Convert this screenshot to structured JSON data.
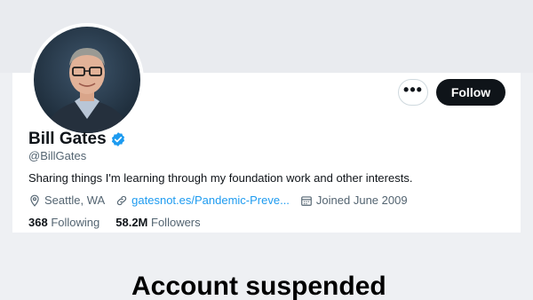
{
  "profile": {
    "name": "Bill Gates",
    "handle": "@BillGates",
    "bio": "Sharing things I'm learning through my foundation work and other interests.",
    "location": "Seattle, WA",
    "website": "gatesnot.es/Pandemic-Preve...",
    "joined": "Joined June 2009",
    "following_count": "368",
    "following_label": "Following",
    "followers_count": "58.2M",
    "followers_label": "Followers",
    "verified": true
  },
  "actions": {
    "more_label": "•••",
    "follow_label": "Follow"
  },
  "overlay": {
    "message": "Account suspended"
  },
  "colors": {
    "accent": "#1d9bf0",
    "follow_bg": "#0f1419",
    "secondary_text": "#536471"
  },
  "icons": [
    "more-icon",
    "verified-badge-icon",
    "location-pin-icon",
    "link-icon",
    "calendar-icon"
  ]
}
